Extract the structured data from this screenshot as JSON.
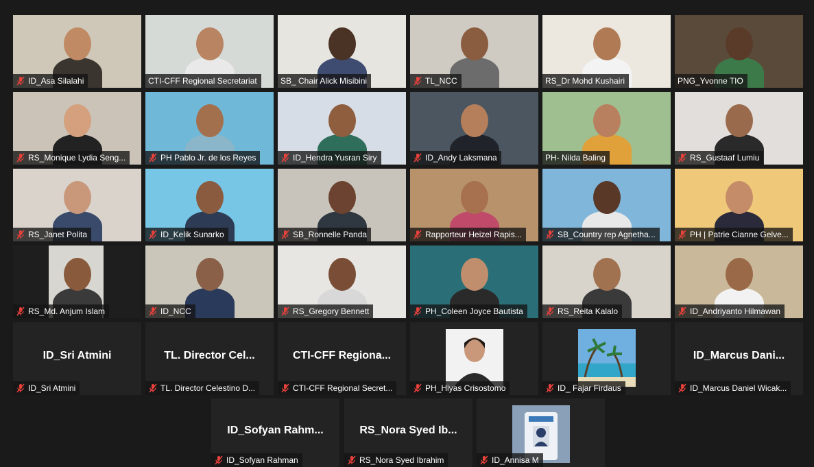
{
  "colors": {
    "background": "#1a1a1a",
    "tile": "#232323",
    "active_speaker": "#cfe86a",
    "muted_icon": "#e8413b"
  },
  "participants": [
    {
      "label": "ID_Asa Silalahi",
      "muted": true,
      "video": true,
      "bg": "#cfc8b8",
      "skin": "#c08a64",
      "shirt": "#3b3530"
    },
    {
      "label": "CTI-CFF Regional Secretariat",
      "muted": false,
      "video": true,
      "bg": "#d6dad7",
      "skin": "#b98462",
      "shirt": "#e9e9e9"
    },
    {
      "label": "SB_ Chair Alick Misibini",
      "muted": false,
      "video": true,
      "bg": "#e7e5e0",
      "skin": "#4a3225",
      "shirt": "#3e4c72"
    },
    {
      "label": "TL_NCC",
      "muted": true,
      "video": true,
      "bg": "#cfcac2",
      "skin": "#8a5c40",
      "shirt": "#6c6c6c"
    },
    {
      "label": "RS_Dr Mohd Kushairi",
      "muted": false,
      "video": true,
      "bg": "#ece8df",
      "skin": "#b07a55",
      "shirt": "#f3f3f3",
      "active": true
    },
    {
      "label": "PNG_Yvonne TIO",
      "muted": false,
      "video": true,
      "bg": "#5a4a3a",
      "skin": "#5a3a28",
      "shirt": "#3c7a4a"
    },
    {
      "label": "RS_Monique Lydia Seng...",
      "muted": true,
      "video": true,
      "bg": "#cbc3b8",
      "skin": "#d4a07e",
      "shirt": "#222222"
    },
    {
      "label": "PH Pablo Jr. de los Reyes",
      "muted": true,
      "video": true,
      "bg": "#6fb8d8",
      "skin": "#a3704e",
      "shirt": "#8bb5c8"
    },
    {
      "label": "ID_Hendra Yusran Siry",
      "muted": true,
      "video": true,
      "bg": "#d7dde6",
      "skin": "#8f5e3f",
      "shirt": "#2e6e5a"
    },
    {
      "label": "ID_Andy Laksmana",
      "muted": true,
      "video": true,
      "bg": "#4b5660",
      "skin": "#b47f5a",
      "shirt": "#20242a"
    },
    {
      "label": "PH- Nilda Baling",
      "muted": false,
      "video": true,
      "bg": "#9fbf90",
      "skin": "#b98060",
      "shirt": "#e0a03a"
    },
    {
      "label": "RS_Gustaaf Lumiu",
      "muted": true,
      "video": true,
      "bg": "#e2dedb",
      "skin": "#9a6a4c",
      "shirt": "#2a2a2a"
    },
    {
      "label": "RS_Janet Polita",
      "muted": true,
      "video": true,
      "bg": "#d9d3cc",
      "skin": "#c9987a",
      "shirt": "#3a4a6a"
    },
    {
      "label": "ID_Kelik Sunarko",
      "muted": true,
      "video": true,
      "bg": "#78c6e6",
      "skin": "#8a5b3e",
      "shirt": "#2d3c54"
    },
    {
      "label": "SB_Ronnelle Panda",
      "muted": true,
      "video": true,
      "bg": "#c9c4bb",
      "skin": "#6b4330",
      "shirt": "#2f3740"
    },
    {
      "label": "Rapporteur Heizel Rapis...",
      "muted": true,
      "video": true,
      "bg": "#b7926a",
      "skin": "#a7704e",
      "shirt": "#c04a6a"
    },
    {
      "label": "SB_Country rep Agnetha...",
      "muted": true,
      "video": true,
      "bg": "#7fb6da",
      "skin": "#5a3828",
      "shirt": "#e8e8e8"
    },
    {
      "label": "PH | Patrie Cianne Gelve...",
      "muted": true,
      "video": true,
      "bg": "#f0c87a",
      "skin": "#c48c68",
      "shirt": "#2a2a3a"
    },
    {
      "label": "RS_Md. Anjum Islam",
      "muted": true,
      "video": true,
      "bg": "#1e1e1e",
      "skin": "#8a5a3c",
      "shirt": "#3a3a3a",
      "inset": true
    },
    {
      "label": "ID_NCC",
      "muted": true,
      "video": true,
      "bg": "#cbc6ba",
      "skin": "#8a6048",
      "shirt": "#2a3a5a"
    },
    {
      "label": "RS_Gregory Bennett",
      "muted": true,
      "video": true,
      "bg": "#e8e6e2",
      "skin": "#7a4e36",
      "shirt": "#d8d8d8"
    },
    {
      "label": "PH_Coleen Joyce Bautista",
      "muted": true,
      "video": true,
      "bg": "#2a6f78",
      "skin": "#c08e6c",
      "shirt": "#2a2a2a"
    },
    {
      "label": "RS_Reita Kalalo",
      "muted": true,
      "video": true,
      "bg": "#d8d4cc",
      "skin": "#a07250",
      "shirt": "#3a3a3a"
    },
    {
      "label": "ID_Andriyanto Hilmawan",
      "muted": true,
      "video": true,
      "bg": "#c9b89a",
      "skin": "#9a6a48",
      "shirt": "#f2f2f2"
    },
    {
      "label": "ID_Sri Atmini",
      "muted": true,
      "video": false,
      "display": "ID_Sri Atmini"
    },
    {
      "label": "TL. Director Celestino D...",
      "muted": true,
      "video": false,
      "display": "TL. Director Cel..."
    },
    {
      "label": "CTI-CFF Regional Secret...",
      "muted": true,
      "video": false,
      "display": "CTI-CFF Regiona..."
    },
    {
      "label": "PH_Hiyas Crisostomo",
      "muted": true,
      "video": false,
      "photo": "portrait"
    },
    {
      "label": "ID_ Fajar Firdaus",
      "muted": true,
      "video": false,
      "photo": "beach"
    },
    {
      "label": "ID_Marcus Daniel Wicak...",
      "muted": true,
      "video": false,
      "display": "ID_Marcus Dani..."
    },
    {
      "label": "ID_Sofyan Rahman",
      "muted": true,
      "video": false,
      "display": "ID_Sofyan Rahm..."
    },
    {
      "label": "RS_Nora Syed Ibrahim",
      "muted": true,
      "video": false,
      "display": "RS_Nora Syed Ib..."
    },
    {
      "label": "ID_Annisa M",
      "muted": true,
      "video": false,
      "photo": "badge"
    }
  ]
}
